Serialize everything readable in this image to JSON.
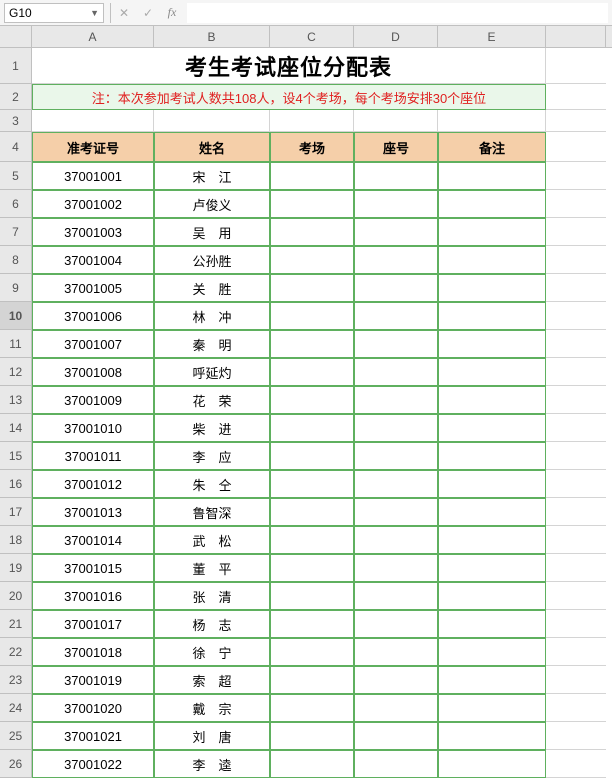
{
  "active_cell": "G10",
  "formula_value": "",
  "columns": [
    "A",
    "B",
    "C",
    "D",
    "E"
  ],
  "title": "考生考试座位分配表",
  "note": "注：本次参加考试人数共108人，设4个考场，每个考场安排30个座位",
  "headers": {
    "id": "准考证号",
    "name": "姓名",
    "room": "考场",
    "seat": "座号",
    "remark": "备注"
  },
  "rows": [
    {
      "row": 5,
      "id": "37001001",
      "name": "宋　江",
      "room": "",
      "seat": "",
      "remark": ""
    },
    {
      "row": 6,
      "id": "37001002",
      "name": "卢俊义",
      "room": "",
      "seat": "",
      "remark": ""
    },
    {
      "row": 7,
      "id": "37001003",
      "name": "吴　用",
      "room": "",
      "seat": "",
      "remark": ""
    },
    {
      "row": 8,
      "id": "37001004",
      "name": "公孙胜",
      "room": "",
      "seat": "",
      "remark": ""
    },
    {
      "row": 9,
      "id": "37001005",
      "name": "关　胜",
      "room": "",
      "seat": "",
      "remark": ""
    },
    {
      "row": 10,
      "id": "37001006",
      "name": "林　冲",
      "room": "",
      "seat": "",
      "remark": ""
    },
    {
      "row": 11,
      "id": "37001007",
      "name": "秦　明",
      "room": "",
      "seat": "",
      "remark": ""
    },
    {
      "row": 12,
      "id": "37001008",
      "name": "呼延灼",
      "room": "",
      "seat": "",
      "remark": ""
    },
    {
      "row": 13,
      "id": "37001009",
      "name": "花　荣",
      "room": "",
      "seat": "",
      "remark": ""
    },
    {
      "row": 14,
      "id": "37001010",
      "name": "柴　进",
      "room": "",
      "seat": "",
      "remark": ""
    },
    {
      "row": 15,
      "id": "37001011",
      "name": "李　应",
      "room": "",
      "seat": "",
      "remark": ""
    },
    {
      "row": 16,
      "id": "37001012",
      "name": "朱　仝",
      "room": "",
      "seat": "",
      "remark": ""
    },
    {
      "row": 17,
      "id": "37001013",
      "name": "鲁智深",
      "room": "",
      "seat": "",
      "remark": ""
    },
    {
      "row": 18,
      "id": "37001014",
      "name": "武　松",
      "room": "",
      "seat": "",
      "remark": ""
    },
    {
      "row": 19,
      "id": "37001015",
      "name": "董　平",
      "room": "",
      "seat": "",
      "remark": ""
    },
    {
      "row": 20,
      "id": "37001016",
      "name": "张　清",
      "room": "",
      "seat": "",
      "remark": ""
    },
    {
      "row": 21,
      "id": "37001017",
      "name": "杨　志",
      "room": "",
      "seat": "",
      "remark": ""
    },
    {
      "row": 22,
      "id": "37001018",
      "name": "徐　宁",
      "room": "",
      "seat": "",
      "remark": ""
    },
    {
      "row": 23,
      "id": "37001019",
      "name": "索　超",
      "room": "",
      "seat": "",
      "remark": ""
    },
    {
      "row": 24,
      "id": "37001020",
      "name": "戴　宗",
      "room": "",
      "seat": "",
      "remark": ""
    },
    {
      "row": 25,
      "id": "37001021",
      "name": "刘　唐",
      "room": "",
      "seat": "",
      "remark": ""
    },
    {
      "row": 26,
      "id": "37001022",
      "name": "李　逵",
      "room": "",
      "seat": "",
      "remark": ""
    }
  ]
}
